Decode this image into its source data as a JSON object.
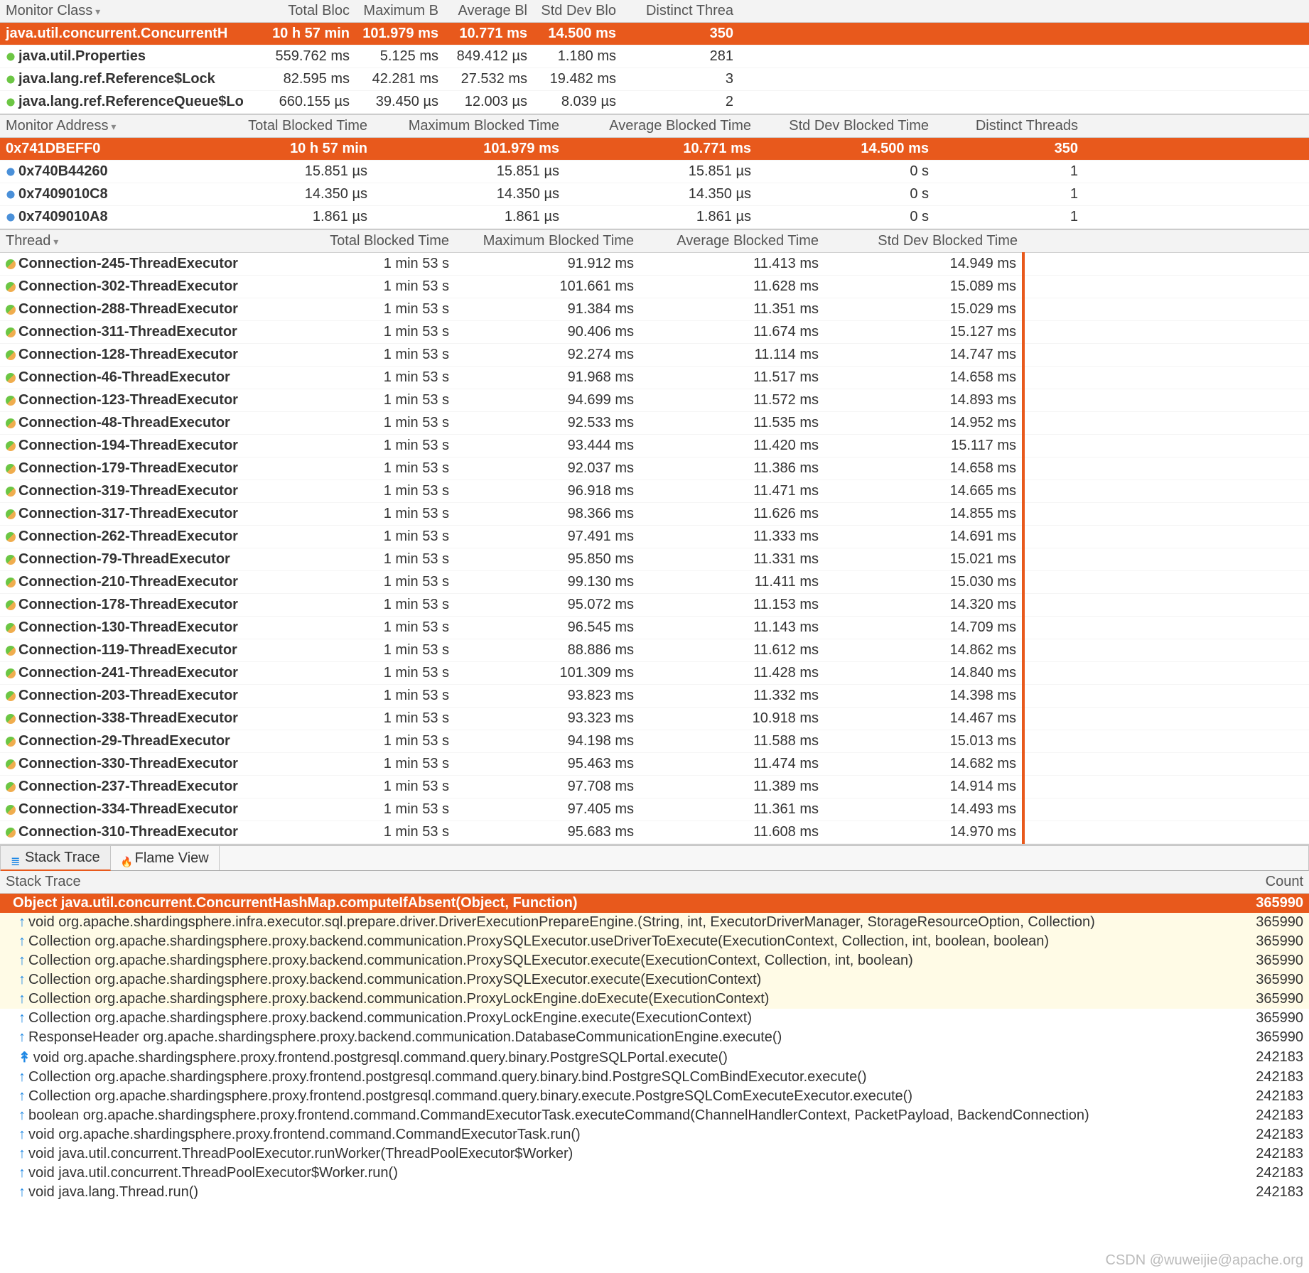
{
  "monitorClass": {
    "headers": [
      "Monitor Class",
      "Total Bloc",
      "Maximum B",
      "Average Bl",
      "Std Dev Blo",
      "Distinct Threa"
    ],
    "rows": [
      {
        "name": "java.util.concurrent.ConcurrentH",
        "total": "10 h 57 min",
        "max": "101.979 ms",
        "avg": "10.771 ms",
        "std": "14.500 ms",
        "threads": "350",
        "sel": true
      },
      {
        "name": "java.util.Properties",
        "total": "559.762 ms",
        "max": "5.125 ms",
        "avg": "849.412 µs",
        "std": "1.180 ms",
        "threads": "281",
        "bold": true,
        "ic": "green"
      },
      {
        "name": "java.lang.ref.Reference$Lock",
        "total": "82.595 ms",
        "max": "42.281 ms",
        "avg": "27.532 ms",
        "std": "19.482 ms",
        "threads": "3",
        "bold": true,
        "ic": "green"
      },
      {
        "name": "java.lang.ref.ReferenceQueue$Lo",
        "total": "660.155 µs",
        "max": "39.450 µs",
        "avg": "12.003 µs",
        "std": "8.039 µs",
        "threads": "2",
        "bold": true,
        "ic": "green"
      }
    ]
  },
  "monitorAddr": {
    "headers": [
      "Monitor Address",
      "Total Blocked Time",
      "Maximum Blocked Time",
      "Average Blocked Time",
      "Std Dev Blocked Time",
      "Distinct Threads"
    ],
    "rows": [
      {
        "addr": "0x741DBEFF0",
        "total": "10 h 57 min",
        "max": "101.979 ms",
        "avg": "10.771 ms",
        "std": "14.500 ms",
        "threads": "350",
        "sel": true
      },
      {
        "addr": "0x740B44260",
        "total": "15.851 µs",
        "max": "15.851 µs",
        "avg": "15.851 µs",
        "std": "0 s",
        "threads": "1"
      },
      {
        "addr": "0x7409010C8",
        "total": "14.350 µs",
        "max": "14.350 µs",
        "avg": "14.350 µs",
        "std": "0 s",
        "threads": "1"
      },
      {
        "addr": "0x7409010A8",
        "total": "1.861 µs",
        "max": "1.861 µs",
        "avg": "1.861 µs",
        "std": "0 s",
        "threads": "1"
      }
    ]
  },
  "threads": {
    "headers": [
      "Thread",
      "Total Blocked Time",
      "Maximum Blocked Time",
      "Average Blocked Time",
      "Std Dev Blocked Time"
    ],
    "rows": [
      {
        "name": "Connection-245-ThreadExecutor",
        "total": "1 min 53 s",
        "max": "91.912 ms",
        "avg": "11.413 ms",
        "std": "14.949 ms"
      },
      {
        "name": "Connection-302-ThreadExecutor",
        "total": "1 min 53 s",
        "max": "101.661 ms",
        "avg": "11.628 ms",
        "std": "15.089 ms"
      },
      {
        "name": "Connection-288-ThreadExecutor",
        "total": "1 min 53 s",
        "max": "91.384 ms",
        "avg": "11.351 ms",
        "std": "15.029 ms"
      },
      {
        "name": "Connection-311-ThreadExecutor",
        "total": "1 min 53 s",
        "max": "90.406 ms",
        "avg": "11.674 ms",
        "std": "15.127 ms"
      },
      {
        "name": "Connection-128-ThreadExecutor",
        "total": "1 min 53 s",
        "max": "92.274 ms",
        "avg": "11.114 ms",
        "std": "14.747 ms"
      },
      {
        "name": "Connection-46-ThreadExecutor",
        "total": "1 min 53 s",
        "max": "91.968 ms",
        "avg": "11.517 ms",
        "std": "14.658 ms"
      },
      {
        "name": "Connection-123-ThreadExecutor",
        "total": "1 min 53 s",
        "max": "94.699 ms",
        "avg": "11.572 ms",
        "std": "14.893 ms"
      },
      {
        "name": "Connection-48-ThreadExecutor",
        "total": "1 min 53 s",
        "max": "92.533 ms",
        "avg": "11.535 ms",
        "std": "14.952 ms"
      },
      {
        "name": "Connection-194-ThreadExecutor",
        "total": "1 min 53 s",
        "max": "93.444 ms",
        "avg": "11.420 ms",
        "std": "15.117 ms"
      },
      {
        "name": "Connection-179-ThreadExecutor",
        "total": "1 min 53 s",
        "max": "92.037 ms",
        "avg": "11.386 ms",
        "std": "14.658 ms"
      },
      {
        "name": "Connection-319-ThreadExecutor",
        "total": "1 min 53 s",
        "max": "96.918 ms",
        "avg": "11.471 ms",
        "std": "14.665 ms"
      },
      {
        "name": "Connection-317-ThreadExecutor",
        "total": "1 min 53 s",
        "max": "98.366 ms",
        "avg": "11.626 ms",
        "std": "14.855 ms"
      },
      {
        "name": "Connection-262-ThreadExecutor",
        "total": "1 min 53 s",
        "max": "97.491 ms",
        "avg": "11.333 ms",
        "std": "14.691 ms"
      },
      {
        "name": "Connection-79-ThreadExecutor",
        "total": "1 min 53 s",
        "max": "95.850 ms",
        "avg": "11.331 ms",
        "std": "15.021 ms"
      },
      {
        "name": "Connection-210-ThreadExecutor",
        "total": "1 min 53 s",
        "max": "99.130 ms",
        "avg": "11.411 ms",
        "std": "15.030 ms"
      },
      {
        "name": "Connection-178-ThreadExecutor",
        "total": "1 min 53 s",
        "max": "95.072 ms",
        "avg": "11.153 ms",
        "std": "14.320 ms"
      },
      {
        "name": "Connection-130-ThreadExecutor",
        "total": "1 min 53 s",
        "max": "96.545 ms",
        "avg": "11.143 ms",
        "std": "14.709 ms"
      },
      {
        "name": "Connection-119-ThreadExecutor",
        "total": "1 min 53 s",
        "max": "88.886 ms",
        "avg": "11.612 ms",
        "std": "14.862 ms"
      },
      {
        "name": "Connection-241-ThreadExecutor",
        "total": "1 min 53 s",
        "max": "101.309 ms",
        "avg": "11.428 ms",
        "std": "14.840 ms"
      },
      {
        "name": "Connection-203-ThreadExecutor",
        "total": "1 min 53 s",
        "max": "93.823 ms",
        "avg": "11.332 ms",
        "std": "14.398 ms"
      },
      {
        "name": "Connection-338-ThreadExecutor",
        "total": "1 min 53 s",
        "max": "93.323 ms",
        "avg": "10.918 ms",
        "std": "14.467 ms"
      },
      {
        "name": "Connection-29-ThreadExecutor",
        "total": "1 min 53 s",
        "max": "94.198 ms",
        "avg": "11.588 ms",
        "std": "15.013 ms"
      },
      {
        "name": "Connection-330-ThreadExecutor",
        "total": "1 min 53 s",
        "max": "95.463 ms",
        "avg": "11.474 ms",
        "std": "14.682 ms"
      },
      {
        "name": "Connection-237-ThreadExecutor",
        "total": "1 min 53 s",
        "max": "97.708 ms",
        "avg": "11.389 ms",
        "std": "14.914 ms"
      },
      {
        "name": "Connection-334-ThreadExecutor",
        "total": "1 min 53 s",
        "max": "97.405 ms",
        "avg": "11.361 ms",
        "std": "14.493 ms"
      },
      {
        "name": "Connection-310-ThreadExecutor",
        "total": "1 min 53 s",
        "max": "95.683 ms",
        "avg": "11.608 ms",
        "std": "14.970 ms"
      }
    ]
  },
  "tabs": {
    "stack": "Stack Trace",
    "flame": "Flame View"
  },
  "stackHeader": {
    "l": "Stack Trace",
    "r": "Count"
  },
  "stack": [
    {
      "txt": "Object java.util.concurrent.ConcurrentHashMap.computeIfAbsent(Object, Function)",
      "count": "365990",
      "sel": true
    },
    {
      "txt": "void org.apache.shardingsphere.infra.executor.sql.prepare.driver.DriverExecutionPrepareEngine.<init>(String, int, ExecutorDriverManager, StorageResourceOption, Collection)",
      "count": "365990",
      "hl": true
    },
    {
      "txt": "Collection org.apache.shardingsphere.proxy.backend.communication.ProxySQLExecutor.useDriverToExecute(ExecutionContext, Collection, int, boolean, boolean)",
      "count": "365990",
      "hl": true
    },
    {
      "txt": "Collection org.apache.shardingsphere.proxy.backend.communication.ProxySQLExecutor.execute(ExecutionContext, Collection, int, boolean)",
      "count": "365990",
      "hl": true
    },
    {
      "txt": "Collection org.apache.shardingsphere.proxy.backend.communication.ProxySQLExecutor.execute(ExecutionContext)",
      "count": "365990",
      "hl": true
    },
    {
      "txt": "Collection org.apache.shardingsphere.proxy.backend.communication.ProxyLockEngine.doExecute(ExecutionContext)",
      "count": "365990",
      "hl": true
    },
    {
      "txt": "Collection org.apache.shardingsphere.proxy.backend.communication.ProxyLockEngine.execute(ExecutionContext)",
      "count": "365990"
    },
    {
      "txt": "ResponseHeader org.apache.shardingsphere.proxy.backend.communication.DatabaseCommunicationEngine.execute()",
      "count": "365990"
    },
    {
      "txt": "void org.apache.shardingsphere.proxy.frontend.postgresql.command.query.binary.PostgreSQLPortal.execute()",
      "count": "242183",
      "split": true
    },
    {
      "txt": "Collection org.apache.shardingsphere.proxy.frontend.postgresql.command.query.binary.bind.PostgreSQLComBindExecutor.execute()",
      "count": "242183"
    },
    {
      "txt": "Collection org.apache.shardingsphere.proxy.frontend.postgresql.command.query.binary.execute.PostgreSQLComExecuteExecutor.execute()",
      "count": "242183"
    },
    {
      "txt": "boolean org.apache.shardingsphere.proxy.frontend.command.CommandExecutorTask.executeCommand(ChannelHandlerContext, PacketPayload, BackendConnection)",
      "count": "242183"
    },
    {
      "txt": "void org.apache.shardingsphere.proxy.frontend.command.CommandExecutorTask.run()",
      "count": "242183"
    },
    {
      "txt": "void java.util.concurrent.ThreadPoolExecutor.runWorker(ThreadPoolExecutor$Worker)",
      "count": "242183"
    },
    {
      "txt": "void java.util.concurrent.ThreadPoolExecutor$Worker.run()",
      "count": "242183"
    },
    {
      "txt": "void java.lang.Thread.run()",
      "count": "242183"
    }
  ],
  "watermark": "CSDN @wuweijie@apache.org"
}
